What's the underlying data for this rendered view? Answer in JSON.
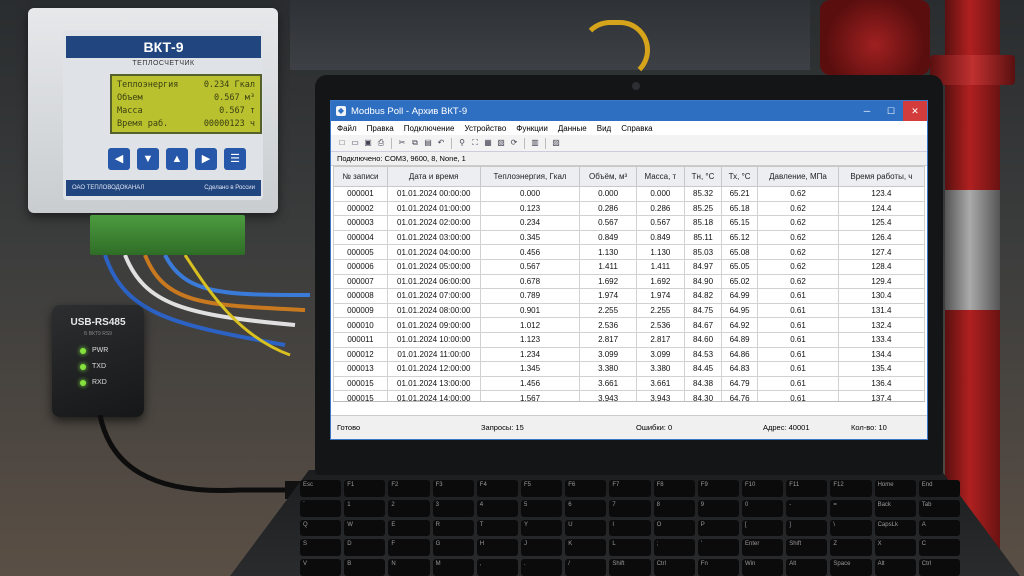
{
  "meter": {
    "model": "ВКТ-9",
    "subtitle": "ТЕПЛОСЧЕТЧИК",
    "lcd": [
      {
        "label": "Теплоэнергия",
        "value": "0.234 Гкал"
      },
      {
        "label": "Объем",
        "value": "0.567 м³"
      },
      {
        "label": "Масса",
        "value": "0.567 т"
      },
      {
        "label": "Время раб.",
        "value": "00000123 ч"
      }
    ],
    "buttons": [
      "◀",
      "▼",
      "▲",
      "▶",
      "☰"
    ],
    "maker": "ОАО ТЕПЛОВОДОКАНАЛ",
    "made_in": "Сделано в России"
  },
  "adapter": {
    "title": "USB-RS485",
    "sub": "Б ВКТ9 RS9",
    "leds": [
      "PWR",
      "TXD",
      "RXD"
    ]
  },
  "window": {
    "title": "Modbus Poll - Архив ВКТ-9",
    "menu": [
      "Файл",
      "Правка",
      "Подключение",
      "Устройство",
      "Функции",
      "Данные",
      "Вид",
      "Справка"
    ],
    "connection": "Подключено: COM3, 9600, 8, None, 1",
    "columns": [
      "№ записи",
      "Дата и время",
      "Теплоэнергия, Гкал",
      "Объём, м³",
      "Масса, т",
      "Тн, °C",
      "Тх, °C",
      "Давление, МПа",
      "Время работы, ч"
    ],
    "rows": [
      [
        "000001",
        "01.01.2024 00:00:00",
        "0.000",
        "0.000",
        "0.000",
        "85.32",
        "65.21",
        "0.62",
        "123.4"
      ],
      [
        "000002",
        "01.01.2024 01:00:00",
        "0.123",
        "0.286",
        "0.286",
        "85.25",
        "65.18",
        "0.62",
        "124.4"
      ],
      [
        "000003",
        "01.01.2024 02:00:00",
        "0.234",
        "0.567",
        "0.567",
        "85.18",
        "65.15",
        "0.62",
        "125.4"
      ],
      [
        "000004",
        "01.01.2024 03:00:00",
        "0.345",
        "0.849",
        "0.849",
        "85.11",
        "65.12",
        "0.62",
        "126.4"
      ],
      [
        "000005",
        "01.01.2024 04:00:00",
        "0.456",
        "1.130",
        "1.130",
        "85.03",
        "65.08",
        "0.62",
        "127.4"
      ],
      [
        "000006",
        "01.01.2024 05:00:00",
        "0.567",
        "1.411",
        "1.411",
        "84.97",
        "65.05",
        "0.62",
        "128.4"
      ],
      [
        "000007",
        "01.01.2024 06:00:00",
        "0.678",
        "1.692",
        "1.692",
        "84.90",
        "65.02",
        "0.62",
        "129.4"
      ],
      [
        "000008",
        "01.01.2024 07:00:00",
        "0.789",
        "1.974",
        "1.974",
        "84.82",
        "64.99",
        "0.61",
        "130.4"
      ],
      [
        "000009",
        "01.01.2024 08:00:00",
        "0.901",
        "2.255",
        "2.255",
        "84.75",
        "64.95",
        "0.61",
        "131.4"
      ],
      [
        "000010",
        "01.01.2024 09:00:00",
        "1.012",
        "2.536",
        "2.536",
        "84.67",
        "64.92",
        "0.61",
        "132.4"
      ],
      [
        "000011",
        "01.01.2024 10:00:00",
        "1.123",
        "2.817",
        "2.817",
        "84.60",
        "64.89",
        "0.61",
        "133.4"
      ],
      [
        "000012",
        "01.01.2024 11:00:00",
        "1.234",
        "3.099",
        "3.099",
        "84.53",
        "64.86",
        "0.61",
        "134.4"
      ],
      [
        "000013",
        "01.01.2024 12:00:00",
        "1.345",
        "3.380",
        "3.380",
        "84.45",
        "64.83",
        "0.61",
        "135.4"
      ],
      [
        "000015",
        "01.01.2024 13:00:00",
        "1.456",
        "3.661",
        "3.661",
        "84.38",
        "64.79",
        "0.61",
        "136.4"
      ],
      [
        "000015",
        "01.01.2024 14:00:00",
        "1.567",
        "3.943",
        "3.943",
        "84.30",
        "64.76",
        "0.61",
        "137.4"
      ]
    ],
    "status": {
      "ready": "Готово",
      "requests": "Запросы: 15",
      "errors": "Ошибки: 0",
      "address": "Адрес: 40001",
      "count": "Кол-во: 10"
    }
  },
  "keyboard": [
    "Esc",
    "F1",
    "F2",
    "F3",
    "F4",
    "F5",
    "F6",
    "F7",
    "F8",
    "F9",
    "F10",
    "F11",
    "F12",
    "Home",
    "End",
    "`",
    "1",
    "2",
    "3",
    "4",
    "5",
    "6",
    "7",
    "8",
    "9",
    "0",
    "-",
    "=",
    "Back",
    "Tab",
    "Q",
    "W",
    "E",
    "R",
    "T",
    "Y",
    "U",
    "I",
    "O",
    "P",
    "[",
    "]",
    "\\",
    "CapsLk",
    "A",
    "S",
    "D",
    "F",
    "G",
    "H",
    "J",
    "K",
    "L",
    ";",
    "'",
    "Enter",
    "Shift",
    "Z",
    "X",
    "C",
    "V",
    "B",
    "N",
    "M",
    ",",
    ".",
    "/",
    "Shift",
    "Ctrl",
    "Fn",
    "Win",
    "Alt",
    "Space",
    "Alt",
    "Ctrl"
  ]
}
